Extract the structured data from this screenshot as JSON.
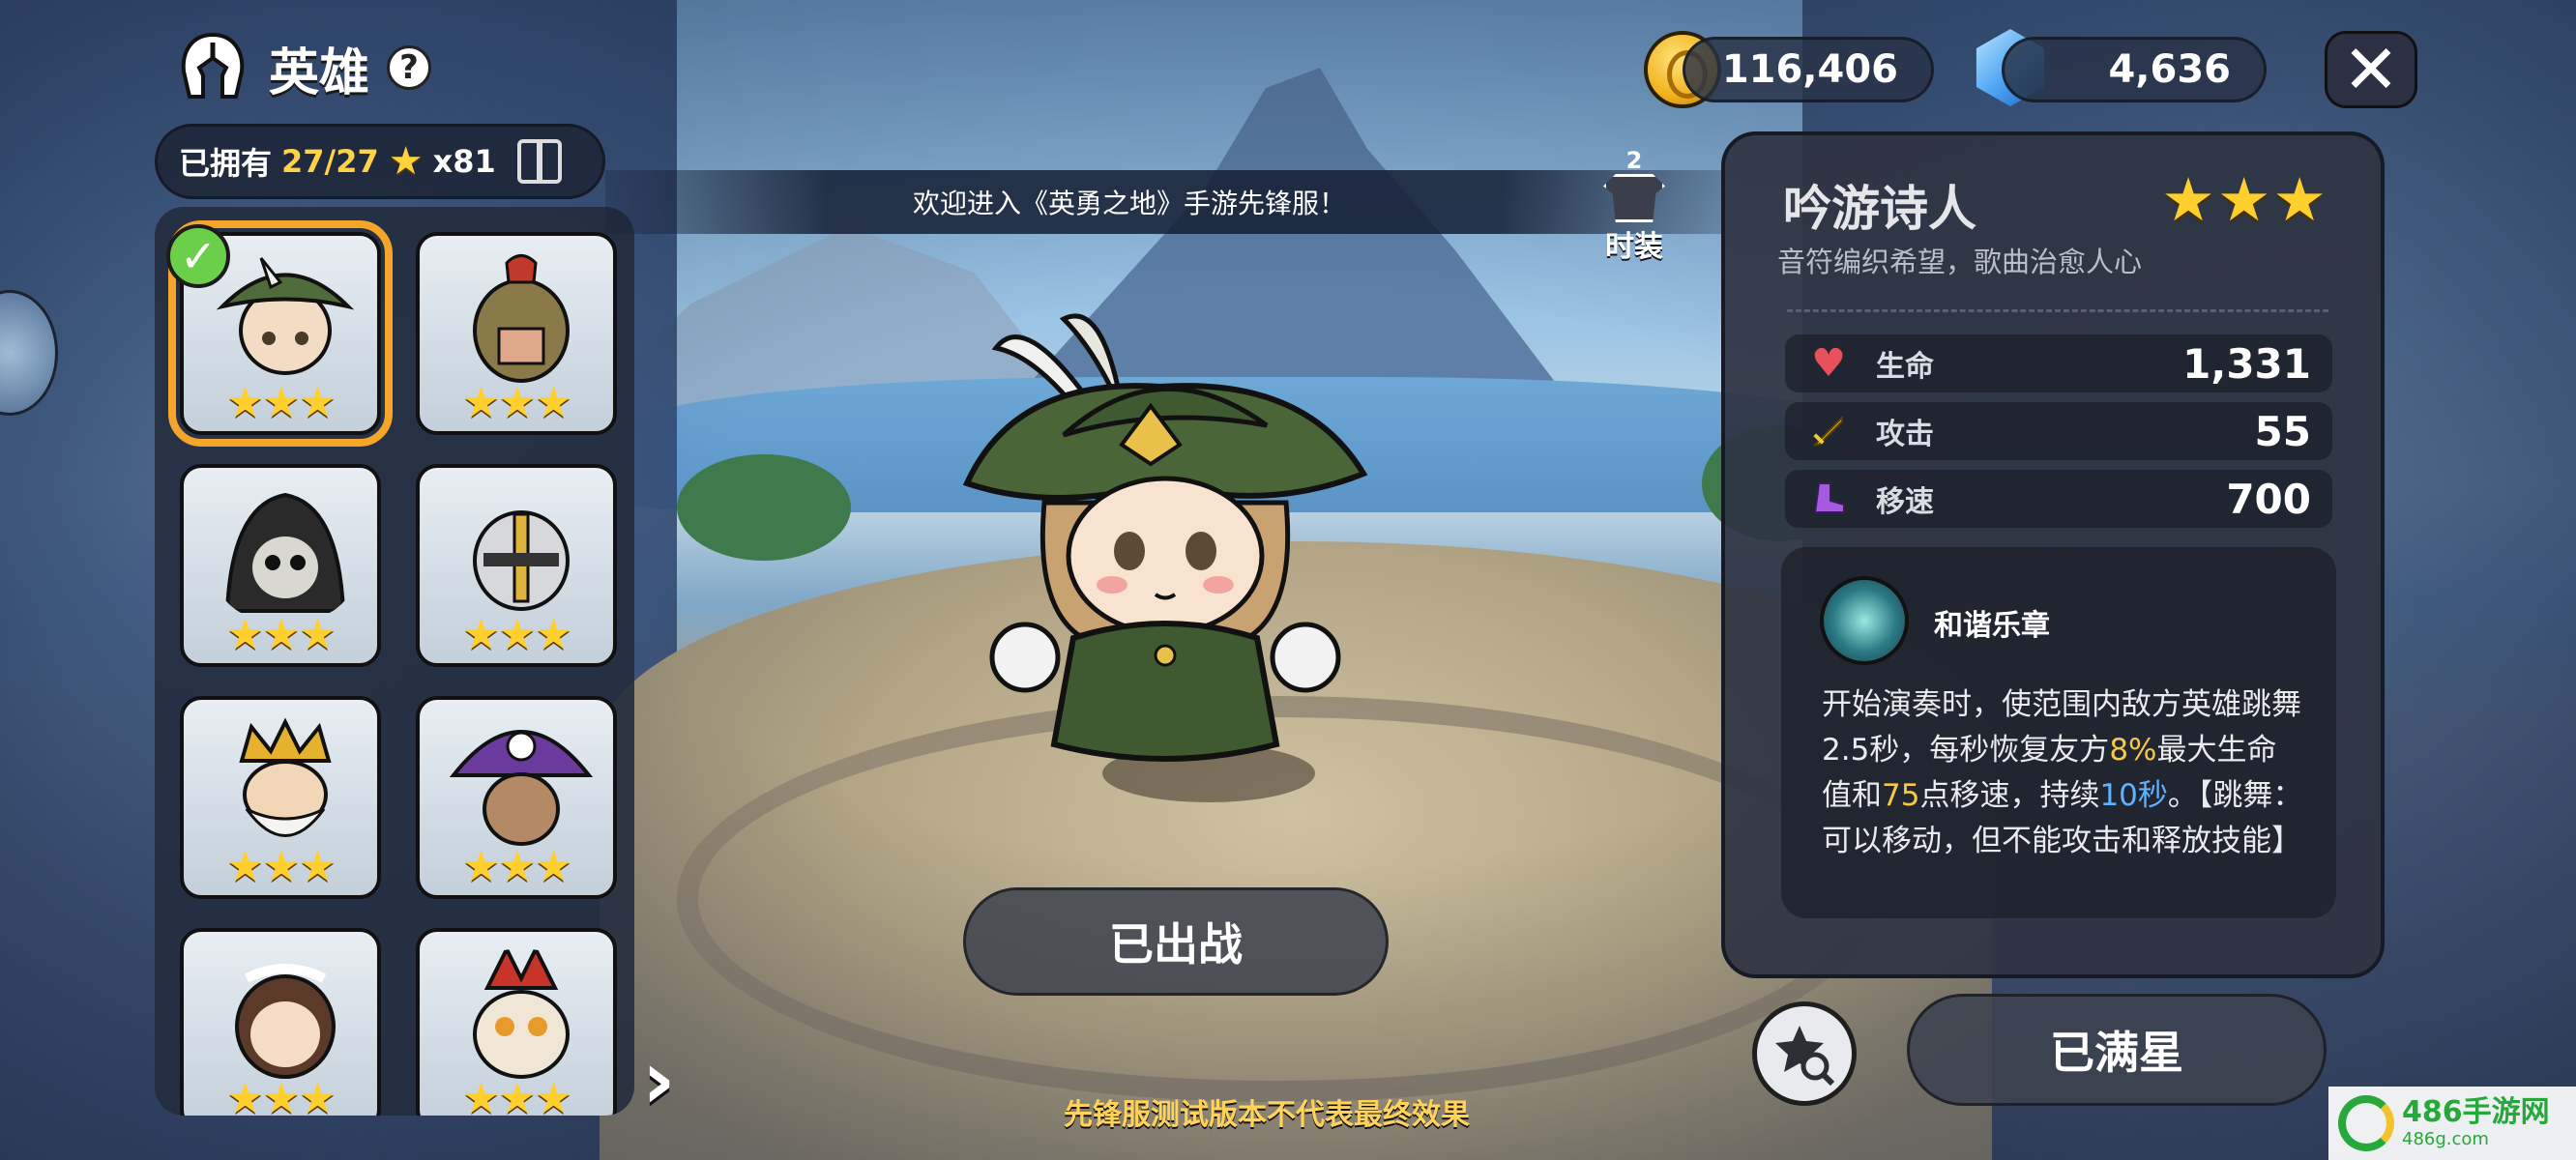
{
  "header": {
    "title": "英雄",
    "help_icon": "?",
    "close_icon": "✕"
  },
  "currency": {
    "coins": "116,406",
    "gems": "4,636"
  },
  "roster": {
    "owned_label": "已拥有",
    "owned_count": "27/27",
    "star_icon": "★",
    "star_count": "x81",
    "heroes": [
      {
        "name": "bard",
        "stars": "★★★",
        "selected": true
      },
      {
        "name": "spartan",
        "stars": "★★★"
      },
      {
        "name": "reaper",
        "stars": "★★★"
      },
      {
        "name": "knight",
        "stars": "★★★"
      },
      {
        "name": "king",
        "stars": "★★★"
      },
      {
        "name": "witch",
        "stars": "★★★"
      },
      {
        "name": "maid",
        "stars": "★★★"
      },
      {
        "name": "owl",
        "stars": "★★★"
      }
    ],
    "next_arrow": "›"
  },
  "notice": {
    "text": "欢迎进入《英勇之地》手游先锋服！"
  },
  "outfit": {
    "badge": "2",
    "label": "时装"
  },
  "center": {
    "deployed_label": "已出战",
    "disclaimer": "先锋服测试版本不代表最终效果"
  },
  "hero_info": {
    "name": "吟游诗人",
    "stars": "★★★",
    "description": "音符编织希望，歌曲治愈人心",
    "stats": [
      {
        "label": "生命",
        "value": "1,331",
        "icon": "heart-icon"
      },
      {
        "label": "攻击",
        "value": "55",
        "icon": "sword-icon"
      },
      {
        "label": "移速",
        "value": "700",
        "icon": "boot-icon"
      }
    ],
    "skill": {
      "name": "和谐乐章",
      "text_parts": {
        "p1": "开始演奏时，使范围内敌方英雄跳舞2.5秒，每秒恢复友方",
        "h1": "8%",
        "p2": "最大生命值和",
        "h2": "75",
        "p3": "点移速，持续",
        "h3": "10秒",
        "p4": "。【跳舞：可以移动，但不能攻击和释放技能】"
      }
    }
  },
  "actions": {
    "max_star_label": "已满星"
  },
  "watermark": {
    "main": "486手游网",
    "sub": "486g.com"
  },
  "colors": {
    "accent_gold": "#ffcf2e",
    "selected_border": "#f4a52a",
    "highlight_yellow": "#f5c84a",
    "highlight_blue": "#5eb2ff"
  }
}
